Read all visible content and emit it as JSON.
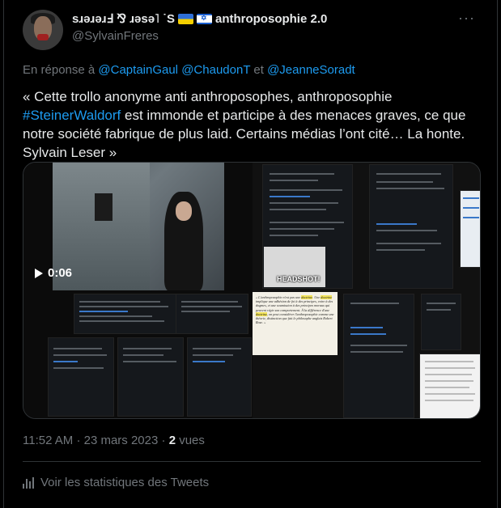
{
  "author": {
    "display_name_prefix": "sɹǝɹǝɹℲ ⅋ ɹǝsǝ˥ ˙S",
    "display_name_suffix": "anthroposophie 2.0",
    "handle": "@SylvainFreres"
  },
  "reply": {
    "prefix": "En réponse à",
    "mentions": [
      "@CaptainGaul",
      "@ChaudonT",
      "@JeanneSoradt"
    ],
    "joiner": "et"
  },
  "tweet": {
    "text_before_hashtag": "« Cette trollo anonyme anti anthroposophes, anthroposophie",
    "hashtag": "#SteinerWaldorf",
    "text_after_hashtag": " est immonde et participe à des menaces graves, ce que notre société fabrique de plus laid. Certains médias l’ont cité… La honte. Sylvain Leser »"
  },
  "media": {
    "video_duration": "0:06",
    "headshot_label": "HEADSHOT!"
  },
  "meta": {
    "time": "11:52 AM",
    "separator": "·",
    "date": "23 mars 2023",
    "views_count": "2",
    "views_label": "vues"
  },
  "stats": {
    "label": "Voir les statistiques des Tweets"
  },
  "icons": {
    "more": "more-icon",
    "play": "play-icon",
    "stats": "analytics-icon",
    "flag_ukraine": "ukraine-flag-icon",
    "flag_israel": "israel-flag-icon"
  },
  "colors": {
    "background": "#000000",
    "text": "#e7e9ea",
    "muted": "#71767b",
    "link": "#1d9bf0",
    "border": "#2f3336"
  }
}
